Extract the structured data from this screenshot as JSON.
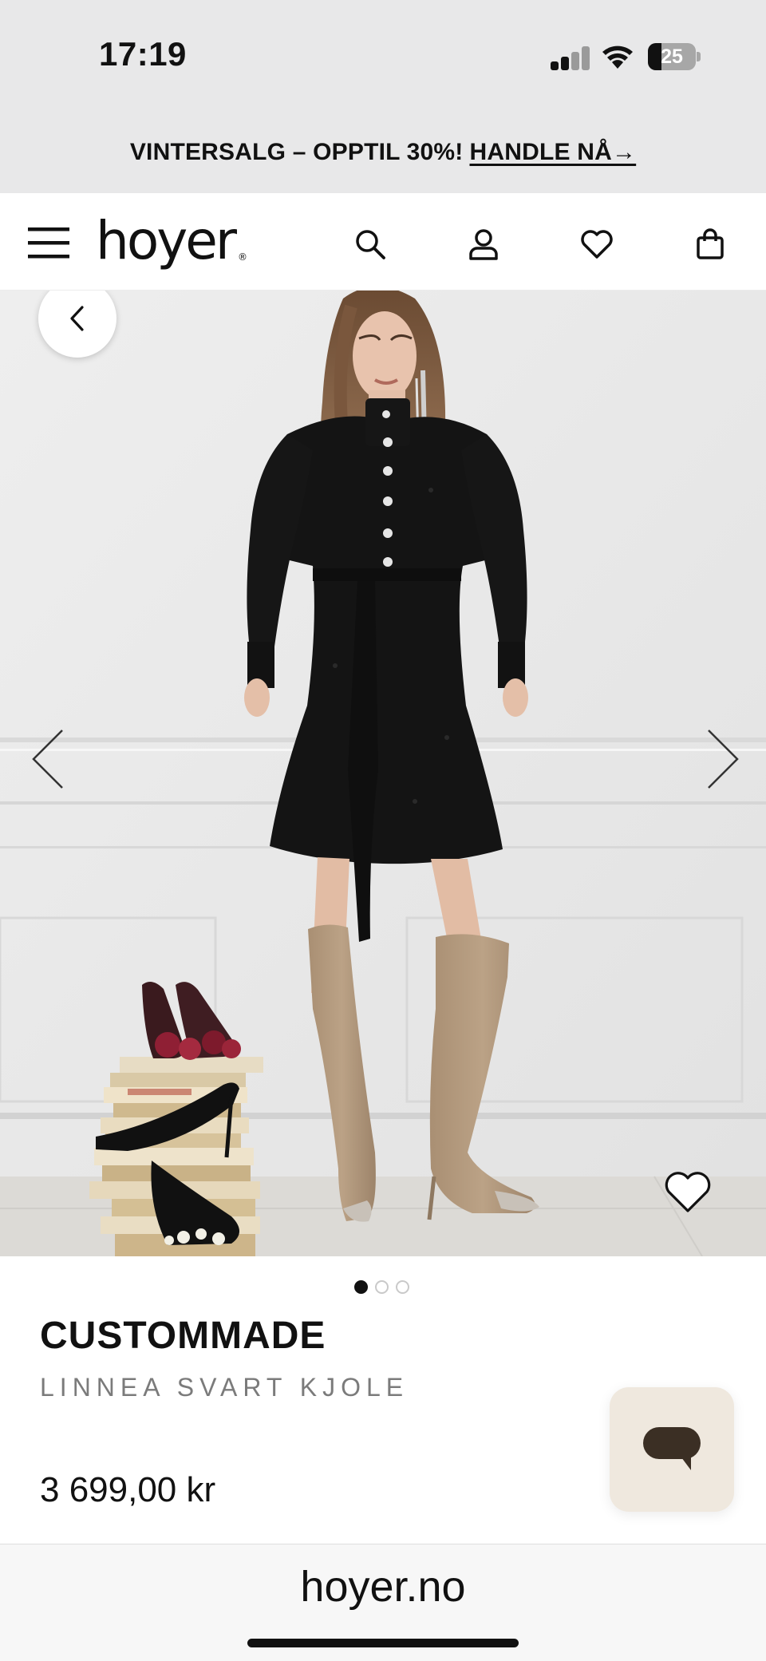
{
  "status_bar": {
    "time": "17:19",
    "battery_level": "25",
    "icons": [
      "cellular-signal-icon",
      "wifi-icon",
      "battery-icon"
    ]
  },
  "promo_banner": {
    "text": "VINTERSALG – OPPTIL 30%!",
    "link": "HANDLE NÅ→"
  },
  "nav": {
    "logo": "hoyer",
    "logo_mark": "®",
    "icons": [
      "menu-icon",
      "search-icon",
      "account-icon",
      "wishlist-icon",
      "bag-icon"
    ]
  },
  "gallery": {
    "image_count": 3,
    "active_index": 0,
    "icons": [
      "chevron-left-icon",
      "arrow-left-icon",
      "arrow-right-icon",
      "heart-icon"
    ]
  },
  "product": {
    "brand": "CUSTOMMADE",
    "name": "LINNEA SVART KJOLE",
    "price": "3 699,00 kr"
  },
  "chat": {
    "icon": "chat-bubble-icon"
  },
  "browser": {
    "url": "hoyer.no"
  },
  "colors": {
    "background": "#ffffff",
    "banner_background": "#e8e8e9",
    "text_primary": "#111111",
    "text_secondary": "#7b7b7b",
    "chat_button": "#efe8de",
    "dress": "#141414",
    "boots": "#b49c80"
  }
}
